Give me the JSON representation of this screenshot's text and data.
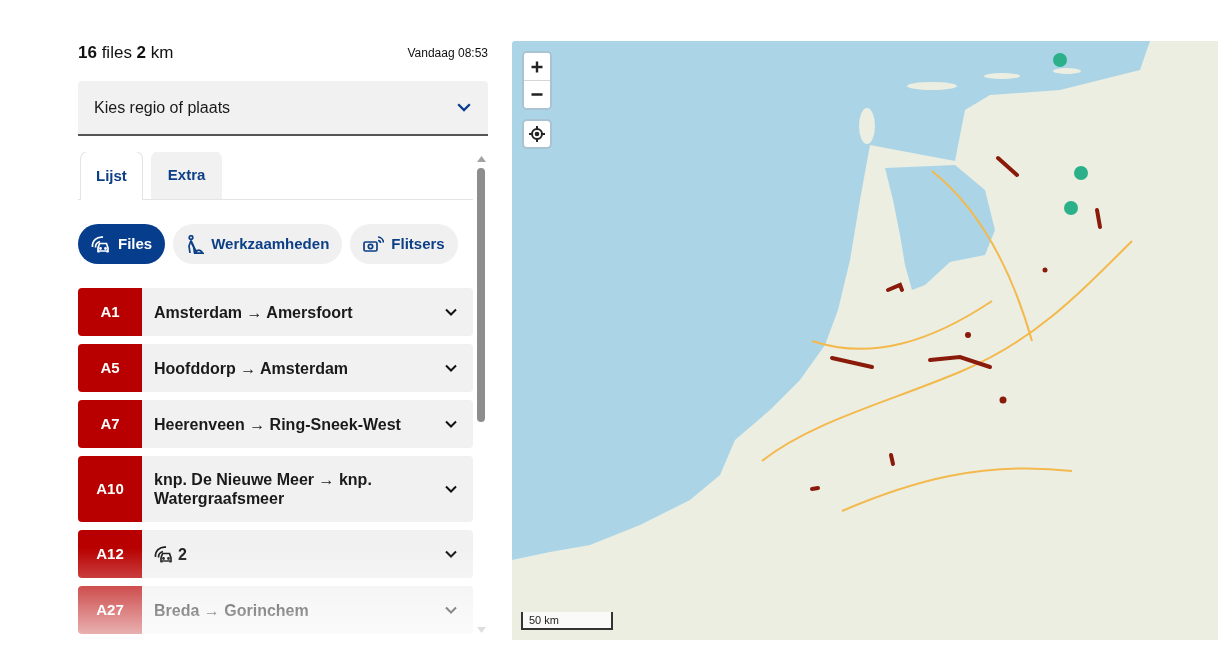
{
  "summary": {
    "counts": "**16** files **2** km",
    "updated": "Vandaag 08:53"
  },
  "region_select": {
    "label": "Kies regio of plaats"
  },
  "tabs": [
    {
      "label": "Lijst",
      "selected": true
    },
    {
      "label": "Extra",
      "selected": false
    }
  ],
  "filters": [
    {
      "kind": "jam",
      "label": "Files",
      "selected": true
    },
    {
      "kind": "roadwork",
      "label": "Werkzaamheden",
      "selected": false
    },
    {
      "kind": "speed_camera",
      "label": "Flitsers",
      "selected": false
    }
  ],
  "traffic_list": [
    {
      "road": "A1",
      "kind": "route",
      "route": "Amsterdam → Amersfoort",
      "expanded": false
    },
    {
      "road": "A5",
      "kind": "route",
      "route": "Hoofddorp → Amsterdam",
      "expanded": false
    },
    {
      "road": "A7",
      "kind": "route",
      "route": "Heerenveen → Ring-Sneek-West",
      "expanded": false
    },
    {
      "road": "A10",
      "kind": "route",
      "route": "knp. De Nieuwe Meer → knp. Watergraafsmeer",
      "expanded": false
    },
    {
      "road": "A12",
      "kind": "count",
      "count": "2",
      "expanded": false
    },
    {
      "road": "A27",
      "kind": "route",
      "route": "Breda → Gorinchem",
      "expanded": false
    }
  ],
  "map": {
    "scale_label": "50 km"
  }
}
